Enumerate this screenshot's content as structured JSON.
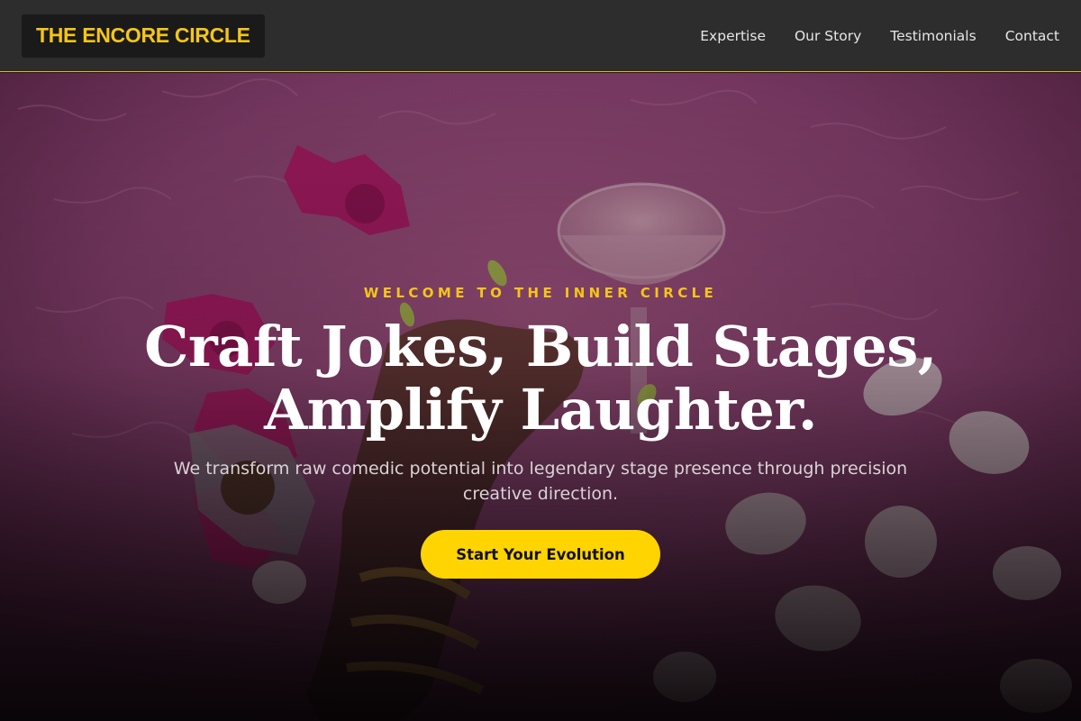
{
  "header": {
    "logo_text": "THE ENCORE CIRCLE",
    "nav": [
      {
        "label": "Expertise"
      },
      {
        "label": "Our Story"
      },
      {
        "label": "Testimonials"
      },
      {
        "label": "Contact"
      }
    ]
  },
  "hero": {
    "eyebrow": "WELCOME TO THE INNER CIRCLE",
    "headline_line1": "Craft Jokes, Build Stages,",
    "headline_line2": "Amplify Laughter.",
    "subtext": "We transform raw comedic potential into legendary stage presence through precision creative direction.",
    "cta_label": "Start Your Evolution"
  },
  "colors": {
    "accent": "#f5c518",
    "cta_bg": "#ffd400",
    "header_bg": "#2d2d2d",
    "hero_tint": "#7a2d5c"
  }
}
